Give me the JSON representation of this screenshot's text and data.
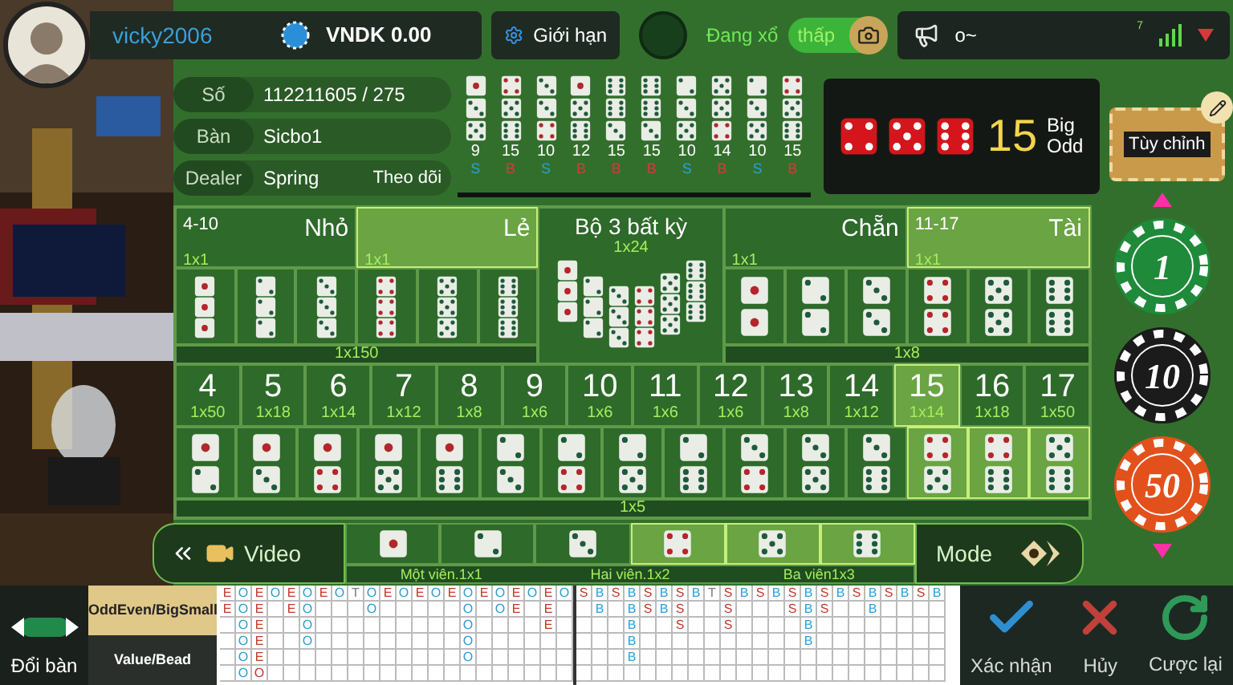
{
  "player": {
    "username": "vicky2006",
    "balance": "VNDK 0.00"
  },
  "limit_button": {
    "label": "Giới hạn"
  },
  "draw_status": {
    "label": "Đang xổ",
    "toggle_label": "thấp",
    "on": true
  },
  "announcement": {
    "text": "o~",
    "signal_label": "7"
  },
  "round_info": [
    {
      "label": "Số",
      "value": "112211605 / 275"
    },
    {
      "label": "Bàn",
      "value": "Sicbo1"
    },
    {
      "label": "Dealer",
      "value": "Spring",
      "action": "Theo dõi"
    }
  ],
  "history": [
    {
      "dice": [
        {
          "kind": "one"
        },
        {
          "kind": "three"
        },
        {
          "kind": "five"
        }
      ],
      "total": "9",
      "result": "S",
      "color": "#2a9fd6"
    },
    {
      "dice": [
        {
          "kind": "four"
        },
        {
          "kind": "five"
        },
        {
          "kind": "six"
        }
      ],
      "total": "15",
      "result": "B",
      "color": "#d23c3c"
    },
    {
      "dice": [
        {
          "kind": "three"
        },
        {
          "kind": "three"
        },
        {
          "kind": "four"
        }
      ],
      "total": "10",
      "result": "S",
      "color": "#2a9fd6"
    },
    {
      "dice": [
        {
          "kind": "one"
        },
        {
          "kind": "five"
        },
        {
          "kind": "six"
        }
      ],
      "total": "12",
      "result": "B",
      "color": "#d23c3c"
    },
    {
      "dice": [
        {
          "kind": "six"
        },
        {
          "kind": "six"
        },
        {
          "kind": "three"
        }
      ],
      "total": "15",
      "result": "B",
      "color": "#d23c3c"
    },
    {
      "dice": [
        {
          "kind": "six"
        },
        {
          "kind": "six"
        },
        {
          "kind": "three"
        }
      ],
      "total": "15",
      "result": "B",
      "color": "#d23c3c"
    },
    {
      "dice": [
        {
          "kind": "two"
        },
        {
          "kind": "three"
        },
        {
          "kind": "five"
        }
      ],
      "total": "10",
      "result": "S",
      "color": "#2a9fd6"
    },
    {
      "dice": [
        {
          "kind": "five"
        },
        {
          "kind": "five"
        },
        {
          "kind": "four"
        }
      ],
      "total": "14",
      "result": "B",
      "color": "#d23c3c"
    },
    {
      "dice": [
        {
          "kind": "two"
        },
        {
          "kind": "three"
        },
        {
          "kind": "five"
        }
      ],
      "total": "10",
      "result": "S",
      "color": "#2a9fd6"
    },
    {
      "dice": [
        {
          "kind": "four"
        },
        {
          "kind": "five"
        },
        {
          "kind": "six"
        }
      ],
      "total": "15",
      "result": "B",
      "color": "#d23c3c"
    }
  ],
  "last_result": {
    "dice": [
      {
        "kind": "four"
      },
      {
        "kind": "five"
      },
      {
        "kind": "six"
      }
    ],
    "total": "15",
    "labels": [
      "Big",
      "Odd"
    ]
  },
  "customize_button": {
    "label": "Tùy chỉnh"
  },
  "board": {
    "left_bets": [
      {
        "range": "4-10",
        "label": "Nhỏ",
        "payout": "1x1",
        "selected": false
      },
      {
        "label": "Lẻ",
        "payout": "1x1",
        "selected": true
      }
    ],
    "triples": {
      "dice": [
        {
          "kind": "one"
        },
        {
          "kind": "two"
        },
        {
          "kind": "three"
        },
        {
          "kind": "four"
        },
        {
          "kind": "five"
        },
        {
          "kind": "six"
        }
      ],
      "payout": "1x150"
    },
    "any_triple": {
      "label": "Bộ 3 bất kỳ",
      "payout": "1x24"
    },
    "right_bets": [
      {
        "label": "Chẵn",
        "payout": "1x1",
        "selected": false
      },
      {
        "label": "Tài",
        "range": "11-17",
        "payout": "1x1",
        "selected": true
      }
    ],
    "doubles": {
      "dice": [
        {
          "kind": "one"
        },
        {
          "kind": "two"
        },
        {
          "kind": "three"
        },
        {
          "kind": "four"
        },
        {
          "kind": "five"
        },
        {
          "kind": "six"
        }
      ],
      "payout": "1x8"
    },
    "totals": [
      {
        "value": "4",
        "payout": "1x50",
        "selected": false
      },
      {
        "value": "5",
        "payout": "1x18",
        "selected": false
      },
      {
        "value": "6",
        "payout": "1x14",
        "selected": false
      },
      {
        "value": "7",
        "payout": "1x12",
        "selected": false
      },
      {
        "value": "8",
        "payout": "1x8",
        "selected": false
      },
      {
        "value": "9",
        "payout": "1x6",
        "selected": false
      },
      {
        "value": "10",
        "payout": "1x6",
        "selected": false
      },
      {
        "value": "11",
        "payout": "1x6",
        "selected": false
      },
      {
        "value": "12",
        "payout": "1x6",
        "selected": false
      },
      {
        "value": "13",
        "payout": "1x8",
        "selected": false
      },
      {
        "value": "14",
        "payout": "1x12",
        "selected": false
      },
      {
        "value": "15",
        "payout": "1x14",
        "selected": true
      },
      {
        "value": "16",
        "payout": "1x18",
        "selected": false
      },
      {
        "value": "17",
        "payout": "1x50",
        "selected": false
      }
    ],
    "combos": {
      "items": [
        {
          "dice": [
            {
              "kind": "one"
            },
            {
              "kind": "two"
            }
          ],
          "selected": false
        },
        {
          "dice": [
            {
              "kind": "one"
            },
            {
              "kind": "three"
            }
          ],
          "selected": false
        },
        {
          "dice": [
            {
              "kind": "one"
            },
            {
              "kind": "four"
            }
          ],
          "selected": false
        },
        {
          "dice": [
            {
              "kind": "one"
            },
            {
              "kind": "five"
            }
          ],
          "selected": false
        },
        {
          "dice": [
            {
              "kind": "one"
            },
            {
              "kind": "six"
            }
          ],
          "selected": false
        },
        {
          "dice": [
            {
              "kind": "two"
            },
            {
              "kind": "three"
            }
          ],
          "selected": false
        },
        {
          "dice": [
            {
              "kind": "two"
            },
            {
              "kind": "four"
            }
          ],
          "selected": false
        },
        {
          "dice": [
            {
              "kind": "two"
            },
            {
              "kind": "five"
            }
          ],
          "selected": false
        },
        {
          "dice": [
            {
              "kind": "two"
            },
            {
              "kind": "six"
            }
          ],
          "selected": false
        },
        {
          "dice": [
            {
              "kind": "three"
            },
            {
              "kind": "four"
            }
          ],
          "selected": false
        },
        {
          "dice": [
            {
              "kind": "three"
            },
            {
              "kind": "five"
            }
          ],
          "selected": false
        },
        {
          "dice": [
            {
              "kind": "three"
            },
            {
              "kind": "six"
            }
          ],
          "selected": false
        },
        {
          "dice": [
            {
              "kind": "four"
            },
            {
              "kind": "five"
            }
          ],
          "selected": true
        },
        {
          "dice": [
            {
              "kind": "four"
            },
            {
              "kind": "six"
            }
          ],
          "selected": true
        },
        {
          "dice": [
            {
              "kind": "five"
            },
            {
              "kind": "six"
            }
          ],
          "selected": true
        }
      ],
      "payout": "1x5"
    }
  },
  "video_button": {
    "label": "Video"
  },
  "singles": {
    "items": [
      {
        "kind": "one",
        "selected": false
      },
      {
        "kind": "two",
        "selected": false
      },
      {
        "kind": "three",
        "selected": false
      },
      {
        "kind": "four",
        "selected": true
      },
      {
        "kind": "five",
        "selected": true
      },
      {
        "kind": "six",
        "selected": true
      }
    ],
    "labels": [
      "Một viên.1x1",
      "Hai viên.1x2",
      "Ba viên1x3"
    ]
  },
  "mode_button": {
    "label": "Mode"
  },
  "chips": [
    {
      "value": "1",
      "color": "#1f8a3a"
    },
    {
      "value": "10",
      "color": "#1b1b1b"
    },
    {
      "value": "50",
      "color": "#e2511c"
    }
  ],
  "change_table": {
    "label": "Đổi bàn"
  },
  "road_tabs": [
    {
      "label": "OddEven/BigSmall",
      "selected": true
    },
    {
      "label": "Value/Bead",
      "selected": false
    }
  ],
  "roadmap": {
    "sections": [
      {
        "columns": [
          {
            "cells": [
              "E",
              "E"
            ],
            "color": "#c0392b"
          },
          {
            "cells": [
              "O",
              "O",
              "O",
              "O",
              "O",
              "O"
            ],
            "color": "#2a9fd6"
          },
          {
            "cells": [
              "E",
              "E",
              "E",
              "E",
              "E",
              "O"
            ],
            "color": "#c0392b"
          },
          {
            "cells": [
              "O"
            ],
            "color": "#2a9fd6"
          },
          {
            "cells": [
              "E",
              "E"
            ],
            "color": "#c0392b"
          },
          {
            "cells": [
              "O",
              "O",
              "O",
              "O"
            ],
            "color": "#2a9fd6"
          },
          {
            "cells": [
              "E"
            ],
            "color": "#c0392b"
          },
          {
            "cells": [
              "O"
            ],
            "color": "#2a9fd6"
          },
          {
            "cells": [
              "T"
            ],
            "color": "#7a7a7a"
          },
          {
            "cells": [
              "O",
              "O"
            ],
            "color": "#2a9fd6"
          },
          {
            "cells": [
              "E"
            ],
            "color": "#c0392b"
          },
          {
            "cells": [
              "O"
            ],
            "color": "#2a9fd6"
          },
          {
            "cells": [
              "E"
            ],
            "color": "#c0392b"
          },
          {
            "cells": [
              "O"
            ],
            "color": "#2a9fd6"
          },
          {
            "cells": [
              "E"
            ],
            "color": "#c0392b"
          },
          {
            "cells": [
              "O",
              "O",
              "O",
              "O",
              "O"
            ],
            "color": "#2a9fd6"
          },
          {
            "cells": [
              "E"
            ],
            "color": "#c0392b"
          },
          {
            "cells": [
              "O",
              "O"
            ],
            "color": "#2a9fd6"
          },
          {
            "cells": [
              "E",
              "E"
            ],
            "color": "#c0392b"
          },
          {
            "cells": [
              "O"
            ],
            "color": "#2a9fd6"
          },
          {
            "cells": [
              "E",
              "E",
              "E"
            ],
            "color": "#c0392b"
          },
          {
            "cells": [
              "O"
            ],
            "color": "#2a9fd6"
          }
        ]
      },
      {
        "columns": [
          {
            "cells": [
              "S"
            ],
            "color": "#c0392b"
          },
          {
            "cells": [
              "B",
              "B"
            ],
            "color": "#2a9fd6"
          },
          {
            "cells": [
              "S"
            ],
            "color": "#c0392b"
          },
          {
            "cells": [
              "B",
              "B",
              "B",
              "B",
              "B"
            ],
            "color": "#2a9fd6"
          },
          {
            "cells": [
              "S",
              "S"
            ],
            "color": "#c0392b"
          },
          {
            "cells": [
              "B",
              "B"
            ],
            "color": "#2a9fd6"
          },
          {
            "cells": [
              "S",
              "S",
              "S"
            ],
            "color": "#c0392b"
          },
          {
            "cells": [
              "B"
            ],
            "color": "#2a9fd6"
          },
          {
            "cells": [
              "T"
            ],
            "color": "#7a7a7a"
          },
          {
            "cells": [
              "S",
              "S",
              "S"
            ],
            "color": "#c0392b"
          },
          {
            "cells": [
              "B"
            ],
            "color": "#2a9fd6"
          },
          {
            "cells": [
              "S"
            ],
            "color": "#c0392b"
          },
          {
            "cells": [
              "B"
            ],
            "color": "#2a9fd6"
          },
          {
            "cells": [
              "S",
              "S"
            ],
            "color": "#c0392b"
          },
          {
            "cells": [
              "B",
              "B",
              "B",
              "B"
            ],
            "color": "#2a9fd6"
          },
          {
            "cells": [
              "S",
              "S"
            ],
            "color": "#c0392b"
          },
          {
            "cells": [
              "B"
            ],
            "color": "#2a9fd6"
          },
          {
            "cells": [
              "S"
            ],
            "color": "#c0392b"
          },
          {
            "cells": [
              "B",
              "B"
            ],
            "color": "#2a9fd6"
          },
          {
            "cells": [
              "S"
            ],
            "color": "#c0392b"
          },
          {
            "cells": [
              "B"
            ],
            "color": "#2a9fd6"
          },
          {
            "cells": [
              "S"
            ],
            "color": "#c0392b"
          },
          {
            "cells": [
              "B"
            ],
            "color": "#2a9fd6"
          }
        ]
      }
    ]
  },
  "actions": [
    {
      "kind": "confirm",
      "label": "Xác nhận"
    },
    {
      "kind": "cancel",
      "label": "Hủy"
    },
    {
      "kind": "rebet",
      "label": "Cược lại"
    }
  ]
}
